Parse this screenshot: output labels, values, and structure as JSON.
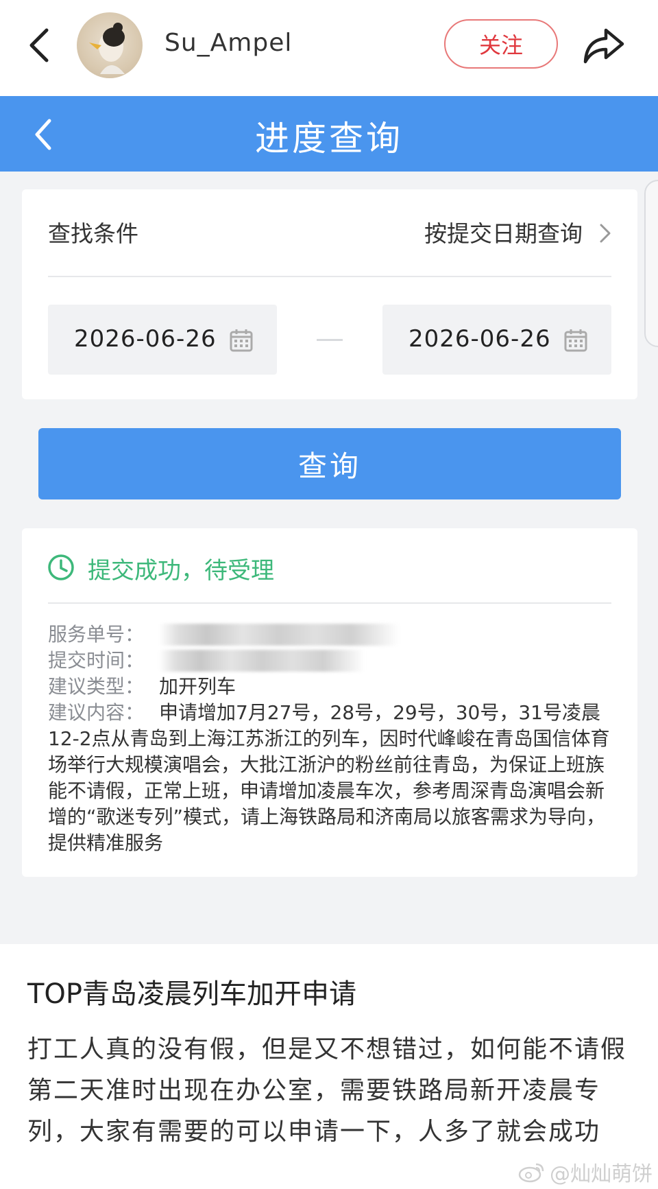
{
  "topbar": {
    "username": "Su_Ampel",
    "follow_label": "关注"
  },
  "appbar": {
    "title": "进度查询"
  },
  "search": {
    "condition_label": "查找条件",
    "condition_value": "按提交日期查询",
    "start_date": "2026-06-26",
    "end_date": "2026-06-26",
    "query_label": "查询"
  },
  "result": {
    "status": "提交成功，待受理",
    "service_no_label": "服务单号：",
    "submit_time_label": "提交时间：",
    "type_label": "建议类型：",
    "type_value": "加开列车",
    "content_label": "建议内容：",
    "content_value": "申请增加7月27号，28号，29号，30号，31号凌晨12-2点从青岛到上海江苏浙江的列车，因时代峰峻在青岛国信体育场举行大规模演唱会，大批江浙沪的粉丝前往青岛，为保证上班族能不请假，正常上班，申请增加凌晨车次，参考周深青岛演唱会新增的“歌迷专列”模式，请上海铁路局和济南局以旅客需求为导向，提供精准服务"
  },
  "post": {
    "title": "TOP青岛凌晨列车加开申请",
    "body": "打工人真的没有假，但是又不想错过，如何能不请假第二天准时出现在办公室，需要铁路局新开凌晨专列，大家有需要的可以申请一下，人多了就会成功",
    "watermark": "@灿灿萌饼"
  },
  "colors": {
    "accent_blue": "#4a95ee",
    "follow_red": "#e0383e",
    "status_green": "#3db87a"
  },
  "icons": [
    "back-arrow-icon",
    "share-icon",
    "calendar-icon",
    "chevron-right-icon",
    "clock-icon",
    "weibo-icon"
  ]
}
